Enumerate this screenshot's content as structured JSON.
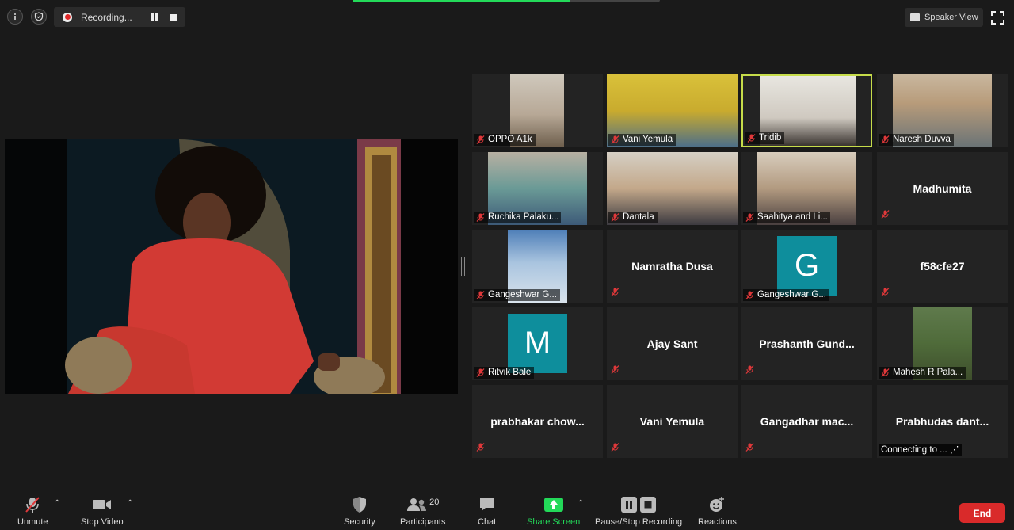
{
  "topbar": {
    "recording_label": "Recording...",
    "speaker_view_label": "Speaker View"
  },
  "participants": [
    {
      "label": "OPPO A1k",
      "type": "video"
    },
    {
      "label": "Vani Yemula",
      "type": "video"
    },
    {
      "label": "Tridib",
      "type": "video",
      "active": true
    },
    {
      "label": "Naresh Duvva",
      "type": "video"
    },
    {
      "label": "Ruchika Palaku...",
      "type": "video"
    },
    {
      "label": "Dantala",
      "type": "video"
    },
    {
      "label": "Saahitya and Li...",
      "type": "video"
    },
    {
      "label": "Madhumita",
      "type": "name"
    },
    {
      "label": "Gangeshwar G...",
      "type": "video"
    },
    {
      "label": "Namratha Dusa",
      "type": "name"
    },
    {
      "label": "Gangeshwar G...",
      "type": "avatar",
      "avatar_letter": "G"
    },
    {
      "label": "f58cfe27",
      "type": "name"
    },
    {
      "label": "Ritvik Bale",
      "type": "avatar",
      "avatar_letter": "M"
    },
    {
      "label": "Ajay Sant",
      "type": "name"
    },
    {
      "label": "Prashanth  Gund...",
      "type": "name"
    },
    {
      "label": "Mahesh R Pala...",
      "type": "video"
    },
    {
      "label": "prabhakar  chow...",
      "type": "name"
    },
    {
      "label": "Vani Yemula",
      "type": "name"
    },
    {
      "label": "Gangadhar  mac...",
      "type": "name"
    },
    {
      "label": "Prabhudas  dant...",
      "type": "name",
      "status": "Connecting to ..."
    }
  ],
  "toolbar": {
    "unmute": "Unmute",
    "stop_video": "Stop Video",
    "security": "Security",
    "participants": "Participants",
    "participants_count": "20",
    "chat": "Chat",
    "share_screen": "Share Screen",
    "pause_stop_recording": "Pause/Stop Recording",
    "reactions": "Reactions",
    "end": "End"
  },
  "colors": {
    "active_speaker_border": "#c6dc4a",
    "share_green": "#23d959",
    "end_red": "#d92a2a",
    "mute_red": "#e0383a",
    "avatar_teal": "#0e8e9c"
  }
}
